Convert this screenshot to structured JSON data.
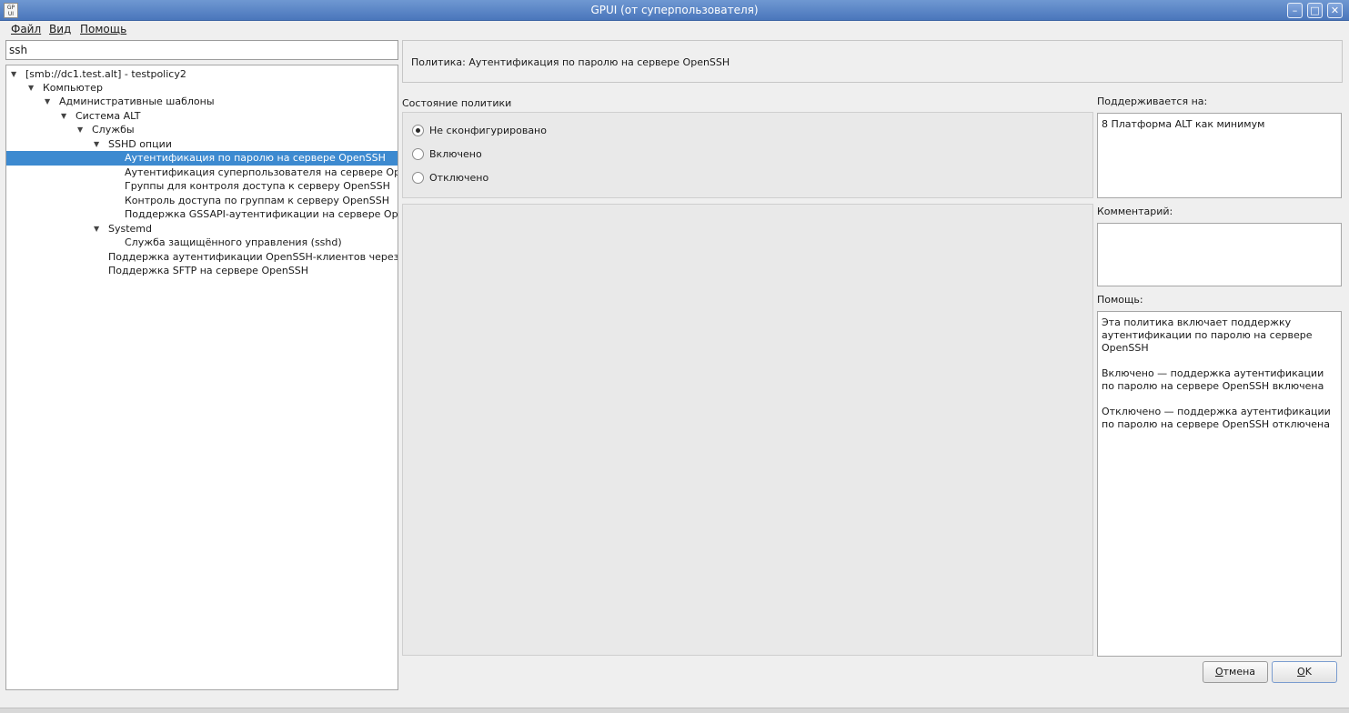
{
  "window": {
    "title": "GPUI (от суперпользователя)",
    "app_icon_text": "GP UI",
    "buttons": {
      "minimize": "–",
      "maximize": "□",
      "close": "✕"
    }
  },
  "menu": [
    {
      "label": "Файл"
    },
    {
      "label": "Вид"
    },
    {
      "label": "Помощь"
    }
  ],
  "search": {
    "value": "ssh"
  },
  "tree": [
    {
      "label": "[smb://dc1.test.alt] - testpolicy2",
      "expanded": true
    },
    {
      "label": "Компьютер",
      "expanded": true
    },
    {
      "label": "Административные шаблоны",
      "expanded": true
    },
    {
      "label": "Система ALT",
      "expanded": true
    },
    {
      "label": "Службы",
      "expanded": true
    },
    {
      "label": "SSHD опции",
      "expanded": true
    },
    {
      "label": "Аутентификация по паролю на сервере OpenSSH",
      "selected": true
    },
    {
      "label": "Аутентификация суперпользователя на сервере Ope..."
    },
    {
      "label": "Группы для контроля доступа к серверу OpenSSH"
    },
    {
      "label": "Контроль доступа по группам к серверу OpenSSH"
    },
    {
      "label": "Поддержка GSSAPI-аутентификации на сервере Ope..."
    },
    {
      "label": "Systemd",
      "expanded": true
    },
    {
      "label": "Служба защищённого управления (sshd)"
    },
    {
      "label": "Поддержка аутентификации OpenSSH-клиентов через G..."
    },
    {
      "label": "Поддержка SFTP на сервере OpenSSH"
    }
  ],
  "policy": {
    "header": "Политика: Аутентификация по паролю на сервере OpenSSH",
    "state_label": "Состояние политики",
    "states": [
      {
        "label": "Не сконфигурировано",
        "checked": true
      },
      {
        "label": "Включено",
        "checked": false
      },
      {
        "label": "Отключено",
        "checked": false
      }
    ],
    "supported_label": "Поддерживается на:",
    "supported_value": "8 Платформа ALT как минимум",
    "comment_label": "Комментарий:",
    "comment_value": "",
    "help_label": "Помощь:",
    "help_paragraphs": [
      "Эта политика включает поддержку аутентификации по паролю на сервере OpenSSH",
      "Включено — поддержка аутентификации по паролю на сервере OpenSSH включена",
      "Отключено — поддержка аутентификации по паролю на сервере OpenSSH отключена"
    ]
  },
  "buttons": {
    "cancel_underlined": "О",
    "cancel_rest": "тмена",
    "ok_underlined": "О",
    "ok_rest": "K"
  },
  "colors": {
    "selection": "#3d8ad0",
    "titlebar": "#5a84c6"
  }
}
